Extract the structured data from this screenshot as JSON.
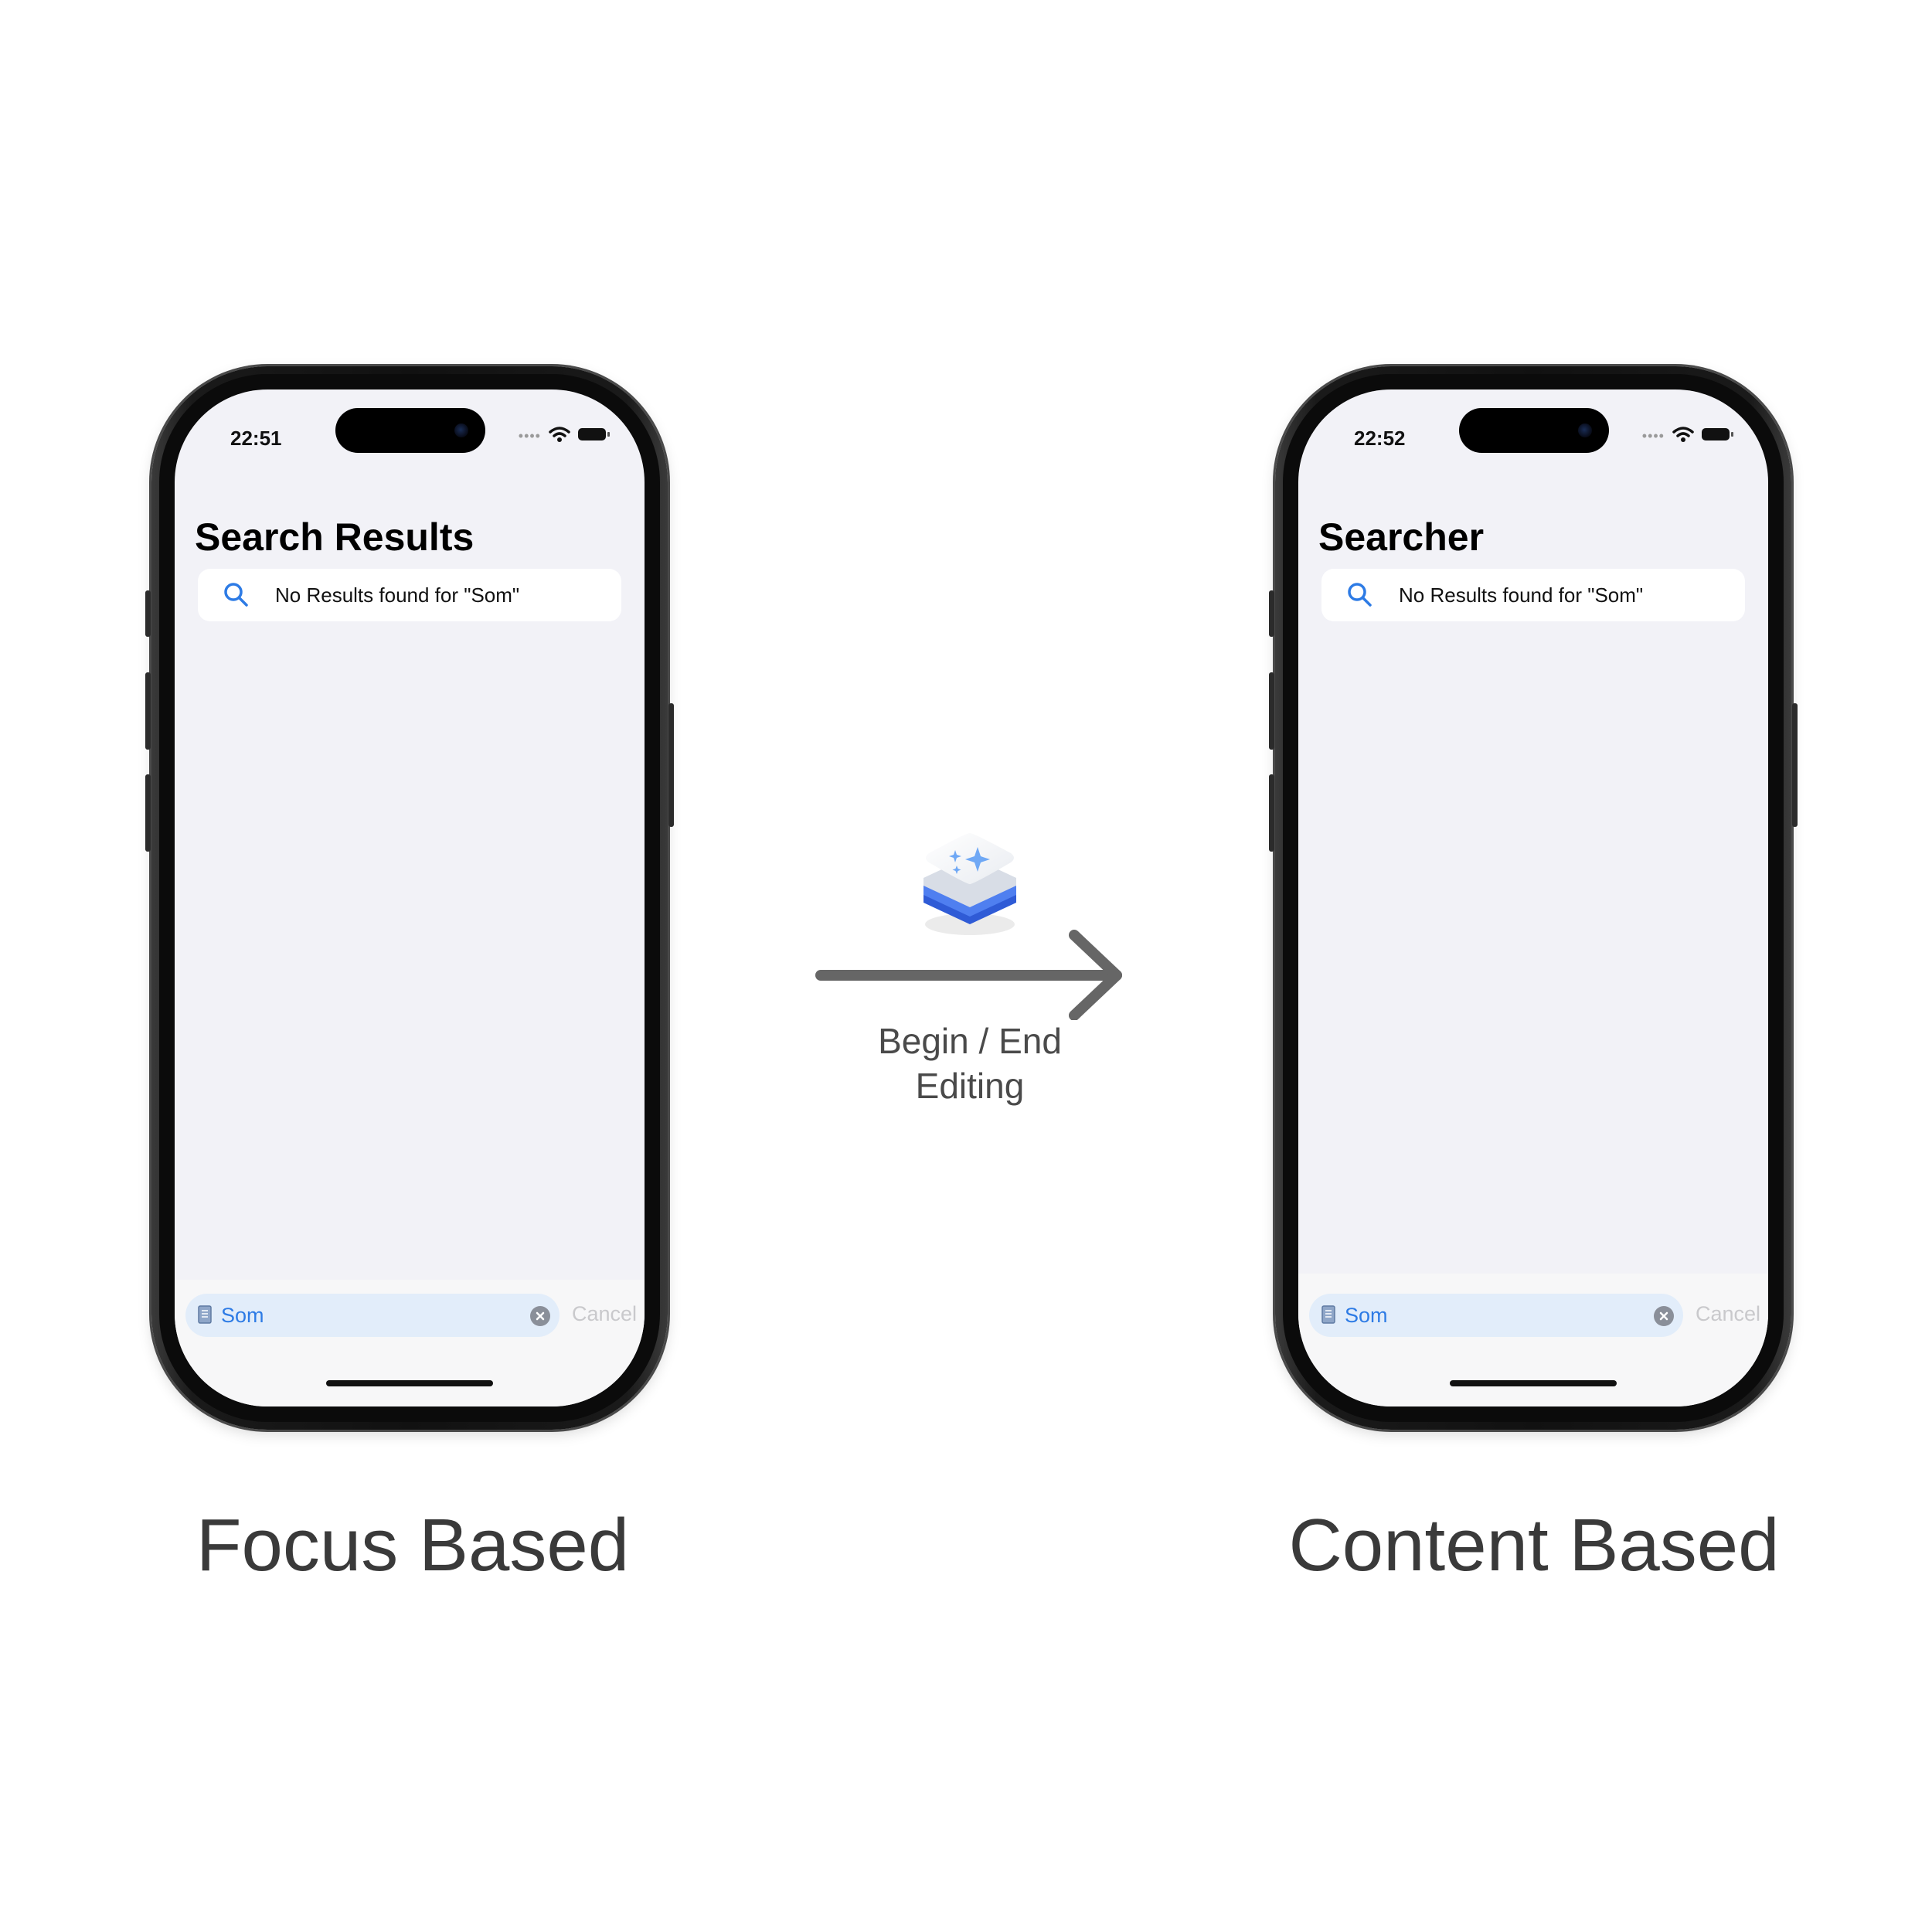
{
  "phones": [
    {
      "status_time": "22:51",
      "nav_title": "Search Results",
      "results_text": "No Results found for \"Som\"",
      "search_value": "Som",
      "cancel_label": "Cancel",
      "caption": "Focus Based"
    },
    {
      "status_time": "22:52",
      "nav_title": "Searcher",
      "results_text": "No Results found for \"Som\"",
      "search_value": "Som",
      "cancel_label": "Cancel",
      "caption": "Content Based"
    }
  ],
  "transition": {
    "label_line1": "Begin / End",
    "label_line2": "Editing"
  },
  "icons": {
    "search": "magnifying-glass-icon",
    "document": "document-icon",
    "clear": "clear-x-icon",
    "wifi": "wifi-icon",
    "battery": "battery-icon",
    "signal": "signal-dots-icon",
    "app": "sparkle-stack-app-icon",
    "arrow": "right-arrow-icon"
  },
  "colors": {
    "accent_blue": "#2d7be5",
    "screen_bg": "#f2f2f7",
    "search_field_bg": "#e2edfa",
    "caption_text": "#3a3a3a"
  }
}
